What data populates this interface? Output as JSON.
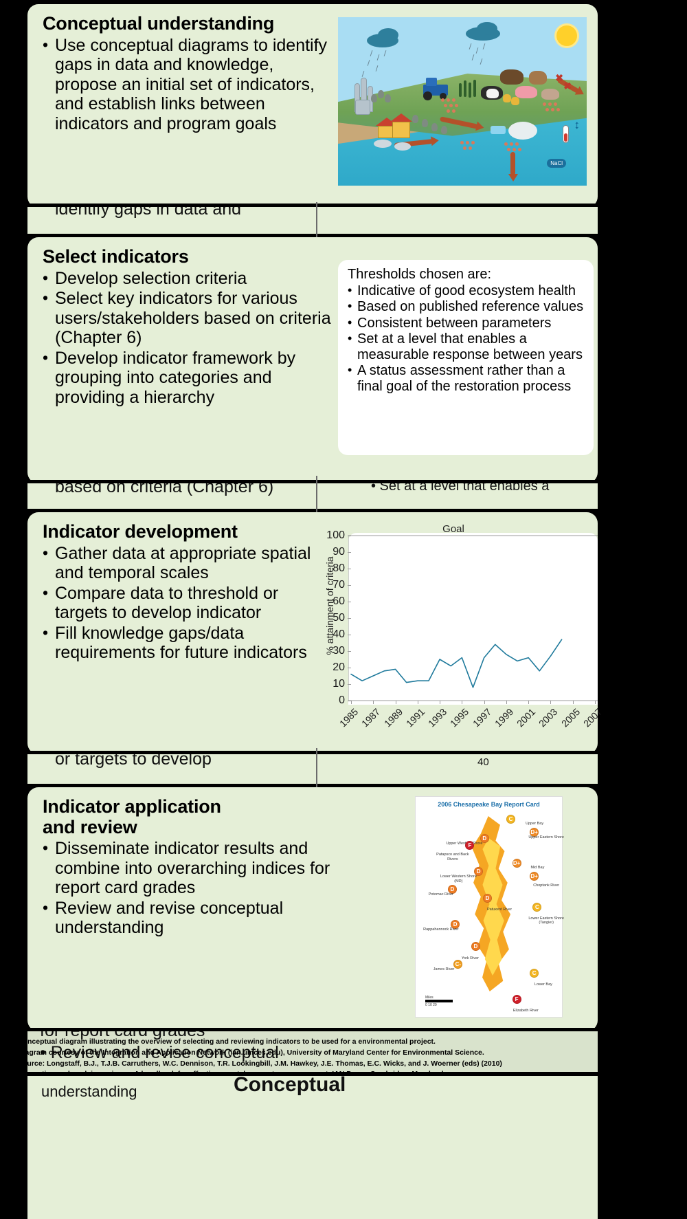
{
  "panels": [
    {
      "id": "conceptual-understanding",
      "title": "Conceptual understanding",
      "bullets": [
        "Use conceptual diagrams to identify gaps in data and knowledge, propose an initial set of indicators, and establish links between indicators and program goals"
      ]
    },
    {
      "id": "select-indicators",
      "title": "Select indicators",
      "bullets": [
        "Develop selection criteria",
        "Select key indicators for various users/stakeholders based on criteria  (Chapter 6)",
        "Develop indicator framework by grouping into categories and providing a hierarchy"
      ]
    },
    {
      "id": "indicator-development",
      "title": "Indicator development",
      "bullets": [
        "Gather data at appropriate spatial and temporal scales",
        "Compare data to threshold or targets to develop indicator",
        "Fill knowledge gaps/data requirements for future indicators"
      ]
    },
    {
      "id": "indicator-application-and-review",
      "title": "Indicator application\nand review",
      "bullets": [
        "Disseminate indicator results and combine into overarching indices for report card grades",
        "Review and revise conceptual understanding"
      ]
    }
  ],
  "thresholds": {
    "lead": "Thresholds chosen are:",
    "items": [
      "Indicative of good ecosystem health",
      "Based on published reference values",
      "Consistent between parameters",
      "Set at a level that enables a measurable response between years",
      "A status assessment rather than a final goal of the restoration process"
    ]
  },
  "chart_data": {
    "type": "line",
    "title": "Goal",
    "xlabel": "",
    "ylabel": "% attainment of criteria",
    "ylim": [
      0,
      100
    ],
    "yticks": [
      0,
      10,
      20,
      30,
      40,
      50,
      60,
      70,
      80,
      90,
      100
    ],
    "xtick_labels": [
      "1985",
      "1987",
      "1989",
      "1991",
      "1993",
      "1995",
      "1997",
      "1999",
      "2001",
      "2003",
      "2005",
      "2007"
    ],
    "x": [
      1985,
      1986,
      1987,
      1988,
      1989,
      1990,
      1991,
      1992,
      1993,
      1994,
      1995,
      1996,
      1997,
      1998,
      1999,
      2000,
      2001,
      2002,
      2003,
      2004,
      2005,
      2006,
      2007
    ],
    "values": [
      16,
      12,
      15,
      18,
      19,
      11,
      12,
      12,
      25,
      21,
      26,
      8,
      26,
      34,
      28,
      24,
      26,
      18,
      27,
      37,
      null,
      null,
      null
    ],
    "series": [
      {
        "name": "% attainment of criteria",
        "color": "#1f7a9c",
        "values": [
          16,
          12,
          15,
          18,
          19,
          11,
          12,
          12,
          25,
          21,
          26,
          8,
          26,
          34,
          28,
          24,
          26,
          18,
          27,
          37
        ]
      }
    ],
    "grid": false,
    "legend": "none"
  },
  "report_card": {
    "title": "2006 Chesapeake Bay Report Card",
    "regions": [
      {
        "name": "Upper Bay",
        "grade": "C",
        "color": "#f5b722"
      },
      {
        "name": "Upper Eastern Shore",
        "grade": "D+",
        "color": "#f08b26"
      },
      {
        "name": "Upper Western Shore",
        "grade": "D",
        "color": "#ef7c23"
      },
      {
        "name": "Patapsco and Back Rivers",
        "grade": "F",
        "color": "#d0202a"
      },
      {
        "name": "Lower Western Shore (MD)",
        "grade": "D",
        "color": "#ef7c23"
      },
      {
        "name": "Mid Bay",
        "grade": "D+",
        "color": "#f08b26"
      },
      {
        "name": "Choptank River",
        "grade": "D+",
        "color": "#f08b26"
      },
      {
        "name": "Potomac River",
        "grade": "D",
        "color": "#ef7c23"
      },
      {
        "name": "Patuxent River",
        "grade": "D",
        "color": "#ef7c23"
      },
      {
        "name": "Lower Eastern Shore (Tangier)",
        "grade": "C",
        "color": "#f5b722"
      },
      {
        "name": "Rappahannock River",
        "grade": "D",
        "color": "#ef7c23"
      },
      {
        "name": "York River",
        "grade": "D",
        "color": "#ef7c23"
      },
      {
        "name": "James River",
        "grade": "C-",
        "color": "#f3a021"
      },
      {
        "name": "Lower Bay",
        "grade": "C",
        "color": "#f5b722"
      },
      {
        "name": "Elizabeth River",
        "grade": "F",
        "color": "#d0202a"
      }
    ],
    "scale": {
      "label": "Miles",
      "ticks": [
        "0",
        "10",
        "20"
      ]
    }
  },
  "caption": {
    "line1": "Conceptual diagram illustrating the overview of selecting and reviewing indicators to be used for a environmental project.",
    "line2": "Diagram courtesy of the Integration and Application Network (ian.umces.edu), University of Maryland Center for Environmental Science. Source: Longstaff, B.J., T.J.B. Carruthers, W.C. Dennison, T.R. Lookingbill, J.M. Hawkey, J.E. Thomas, E.C. Wicks, and J. Woerner (eds) (2010) Integrating and applying science: A handbook for effective coastal ecosystem assessment. IAN Press, Cambridge, Maryland."
  },
  "colors": {
    "panel_bg": "#e5efd7",
    "page_bg": "#000000",
    "card_bg": "#ffffff",
    "line": "#1f7a9c",
    "arrow": "#6b6b6b"
  }
}
